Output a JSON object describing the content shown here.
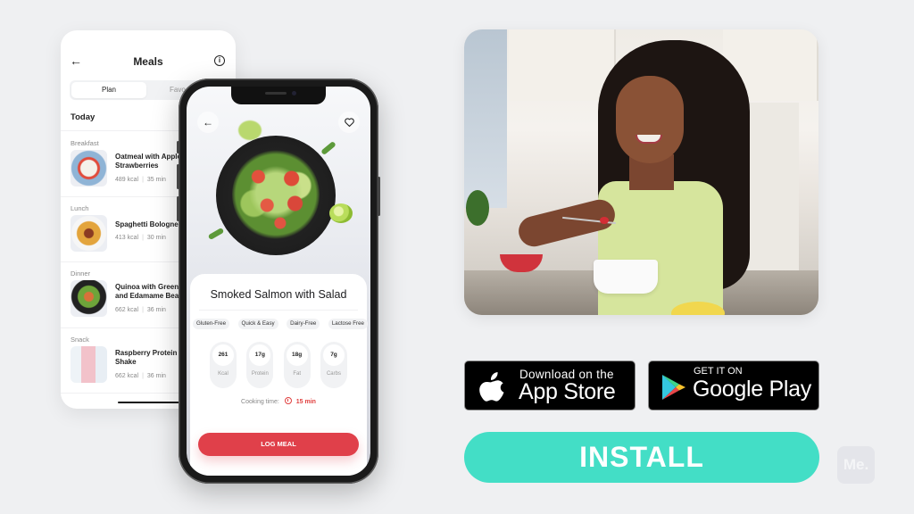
{
  "meals_screen": {
    "title": "Meals",
    "back_icon": "arrow-left-icon",
    "info_icon": "info-icon",
    "tabs": [
      {
        "label": "Plan",
        "active": true
      },
      {
        "label": "Favo",
        "active": false
      }
    ],
    "day_label": "Today",
    "sections": [
      {
        "label": "Breakfast",
        "name": "Oatmeal with Apple\nStrawberries",
        "kcal": "489 kcal",
        "time": "35 min"
      },
      {
        "label": "Lunch",
        "name": "Spaghetti Bologne",
        "kcal": "413 kcal",
        "time": "30 min"
      },
      {
        "label": "Dinner",
        "name": "Quinoa with Green\nand Edamame Bea",
        "kcal": "662 kcal",
        "time": "36 min"
      },
      {
        "label": "Snack",
        "name": "Raspberry Protein\nShake",
        "kcal": "662 kcal",
        "time": "36 min"
      }
    ]
  },
  "detail_screen": {
    "back_icon": "arrow-left-icon",
    "favorite_icon": "heart-icon",
    "title": "Smoked Salmon with Salad",
    "tags": [
      "Gluten-Free",
      "Quick & Easy",
      "Dairy-Free",
      "Lactose Free"
    ],
    "macros": [
      {
        "value": "261",
        "label": "Kcal"
      },
      {
        "value": "17g",
        "label": "Protein"
      },
      {
        "value": "18g",
        "label": "Fat"
      },
      {
        "value": "7g",
        "label": "Carbs"
      }
    ],
    "cooking_time_label": "Cooking time:",
    "cooking_time_value": "15 min",
    "log_button": "LOG MEAL",
    "accent_color": "#e0404a"
  },
  "store_badges": {
    "apple": {
      "small": "Download on the",
      "big": "App Store"
    },
    "google": {
      "small": "GET IT ON",
      "big": "Google Play"
    }
  },
  "install_button": {
    "label": "INSTALL",
    "color": "#43dec6"
  },
  "brand_logo": "Me."
}
